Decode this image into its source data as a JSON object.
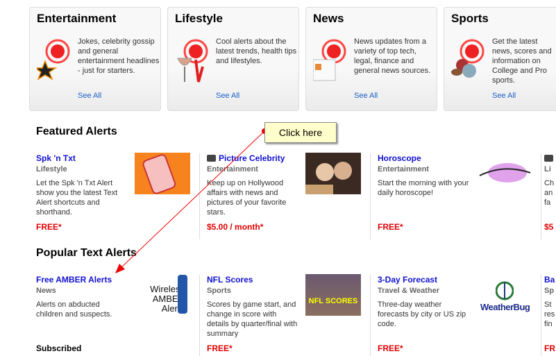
{
  "categories": [
    {
      "title": "Entertainment",
      "desc": "Jokes, celebrity gossip and general entertainment headlines - just for starters.",
      "link": "See All",
      "icon": "star-bell-icon"
    },
    {
      "title": "Lifestyle",
      "desc": "Cool alerts about the latest trends, health tips and lifestyles.",
      "link": "See All",
      "icon": "wineglass-bell-icon"
    },
    {
      "title": "News",
      "desc": "News updates from a variety of top tech, legal, finance and general news sources.",
      "link": "See All",
      "icon": "newspaper-bell-icon"
    },
    {
      "title": "Sports",
      "desc": "Get the latest news, scores and information on College and Pro sports.",
      "link": "See All",
      "icon": "balls-bell-icon"
    }
  ],
  "featured": {
    "heading": "Featured Alerts",
    "items": [
      {
        "title": "Spk 'n Txt",
        "category": "Lifestyle",
        "desc": "Let the Spk 'n Txt Alert show you the latest Text Alert shortcuts and shorthand.",
        "price": "FREE*"
      },
      {
        "title": "Picture Celebrity",
        "category": "Entertainment",
        "desc": "Keep up on Hollywood affairs with news and pictures of your favorite stars.",
        "price": "$5.00 / month*"
      },
      {
        "title": "Horoscope",
        "category": "Entertainment",
        "desc": "Start the morning with your daily horoscope!",
        "price": "FREE*"
      },
      {
        "title": "",
        "category": "Li",
        "desc": "Ch an fa",
        "price": "$5"
      }
    ]
  },
  "popular": {
    "heading": "Popular Text Alerts",
    "items": [
      {
        "title": "Free AMBER Alerts",
        "category": "News",
        "desc": "Alerts on abducted children and suspects.",
        "price": "Subscribed",
        "logo": "Wireless AMBER Alerts"
      },
      {
        "title": "NFL Scores",
        "category": "Sports",
        "desc": "Scores by game start, and change in score with details by quarter/final with summary",
        "price": "FREE*",
        "logo": "NFL SCORES"
      },
      {
        "title": "3-Day Forecast",
        "category": "Travel & Weather",
        "desc": "Three-day weather forecasts by city or US zip code.",
        "price": "FREE*",
        "logo": "WeatherBug"
      },
      {
        "title": "Ba",
        "category": "Sp",
        "desc": "St res fin",
        "price": "FR"
      }
    ]
  },
  "callout": {
    "text": "Click here"
  },
  "colors": {
    "link": "#1010d0",
    "price": "#e00000",
    "see_all": "#1a5fc8"
  }
}
